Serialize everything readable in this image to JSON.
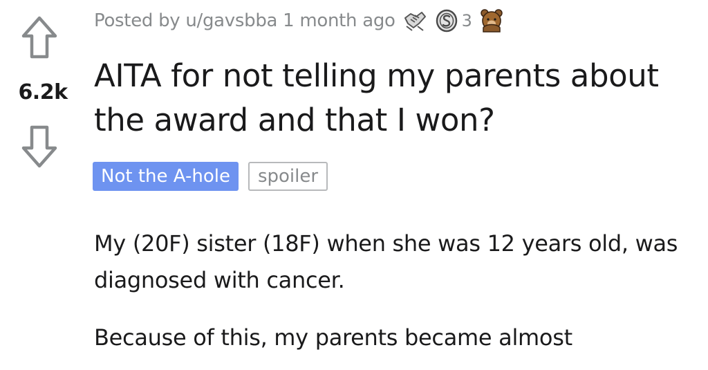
{
  "post": {
    "vote": {
      "score": "6.2k",
      "upvote_icon": "upvote-arrow-icon",
      "downvote_icon": "downvote-arrow-icon"
    },
    "meta": {
      "posted_by": "Posted by u/gavsbba 1 month ago",
      "awards": [
        {
          "icon": "handshake-award-icon"
        },
        {
          "icon": "silver-coin-award-icon",
          "count": "3"
        },
        {
          "icon": "facepalm-bear-award-icon"
        }
      ]
    },
    "title": "AITA for not telling my parents about the award and that I won?",
    "flairs": {
      "verdict": "Not the A-hole",
      "spoiler": "spoiler"
    },
    "body": [
      "My (20F) sister (18F) when she was 12 years old, was diagnosed with cancer.",
      "Because of this, my parents became almost"
    ]
  },
  "colors": {
    "flair_blue": "#6e93f0",
    "muted_text": "#878a8c",
    "main_text": "#1a1a1b",
    "arrow_stroke": "#878a8c"
  }
}
